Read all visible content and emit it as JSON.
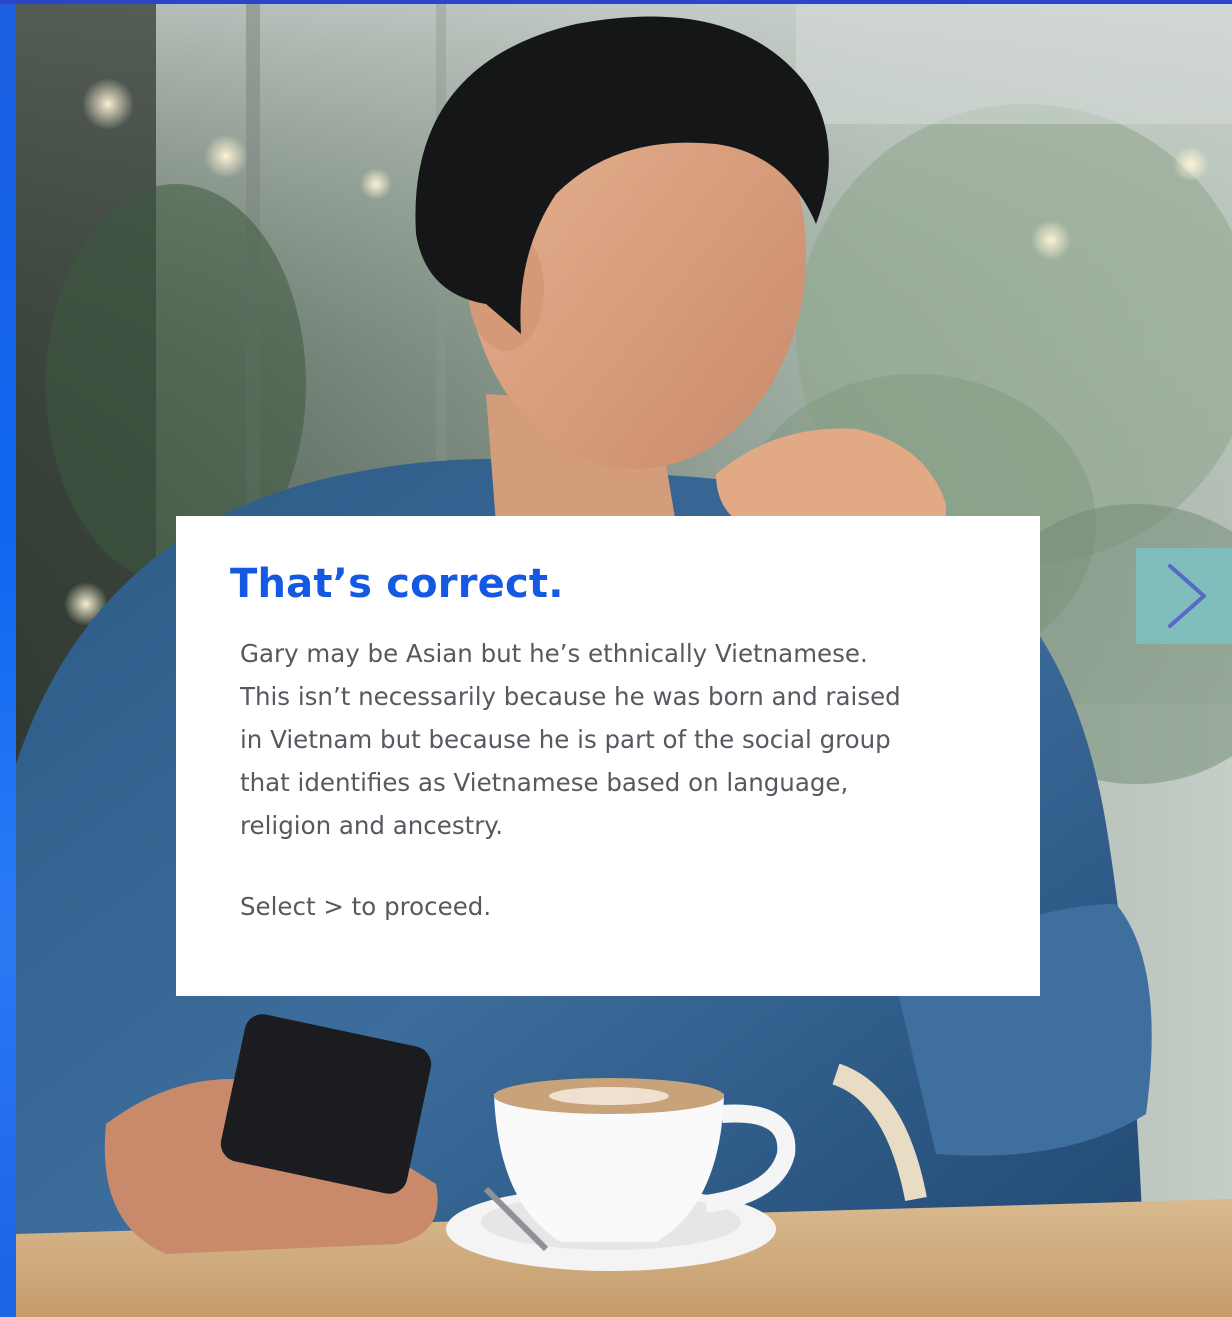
{
  "feedback": {
    "title": "That’s correct.",
    "body": "Gary may be Asian but he’s ethnically Vietnamese.\nThis isn’t necessarily because he was born and raised\nin Vietnam but because he is part of the social group\nthat identifies as Vietnamese based on language,\nreligion and ancestry.",
    "instruction": "Select > to proceed."
  },
  "navigation": {
    "next_icon": "chevron-right-icon"
  },
  "colors": {
    "title": "#1459e2",
    "body_text": "#555a60",
    "top_border": "#2b44c9",
    "left_strip": "#1b5fe0",
    "next_button_bg": "#78c8cd",
    "next_chevron": "#5a68c8"
  }
}
